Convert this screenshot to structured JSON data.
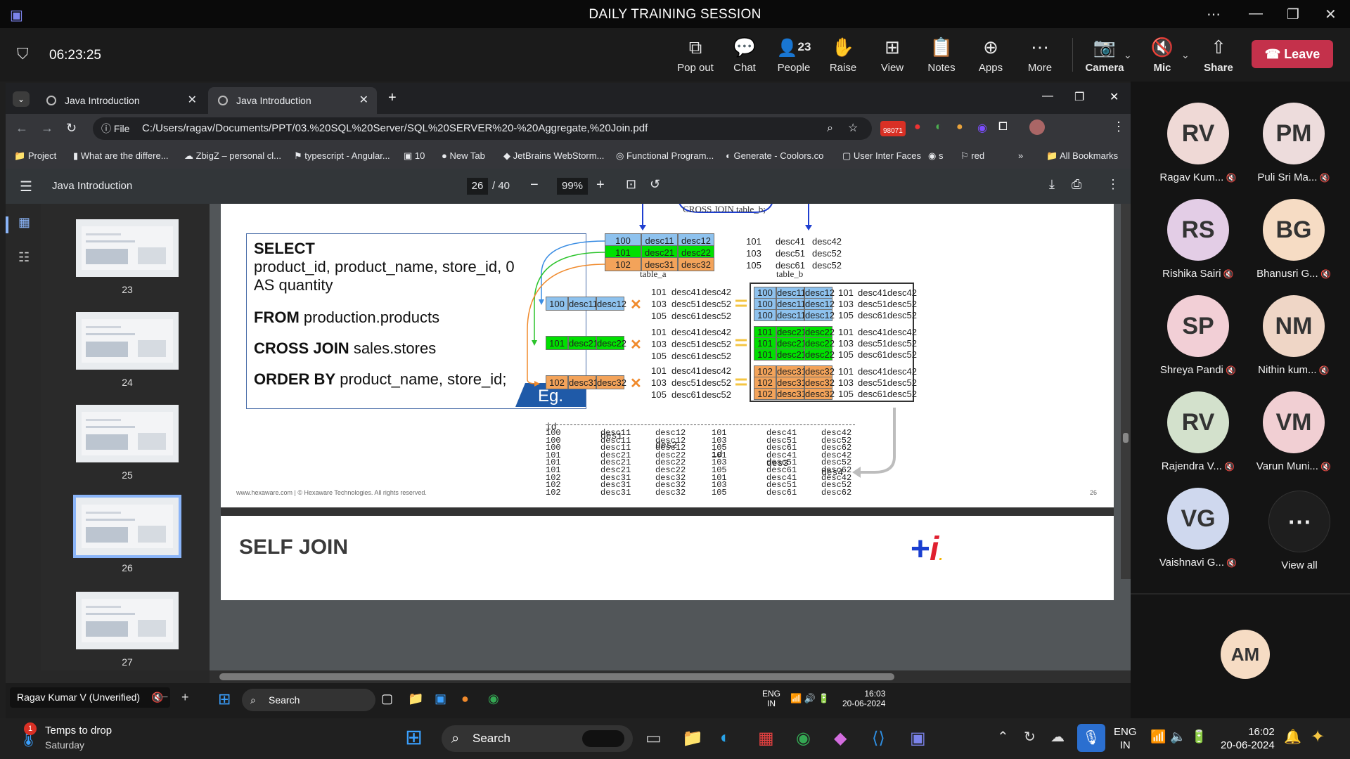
{
  "meeting": {
    "title": "DAILY TRAINING SESSION",
    "timer": "06:23:25",
    "toolbar": {
      "popout": "Pop out",
      "chat": "Chat",
      "people": "People",
      "people_count": "23",
      "raise": "Raise",
      "view": "View",
      "notes": "Notes",
      "apps": "Apps",
      "more": "More",
      "camera": "Camera",
      "mic": "Mic",
      "share": "Share",
      "leave": "Leave"
    }
  },
  "browser": {
    "tabs": [
      {
        "label": "Java Introduction"
      },
      {
        "label": "Java Introduction"
      }
    ],
    "file_label": "File",
    "url": "C:/Users/ragav/Documents/PPT/03.%20SQL%20Server/SQL%20SERVER%20-%20Aggregate,%20Join.pdf",
    "ext_badge": "98071",
    "bookmarks": [
      "Project",
      "What are the differe...",
      "ZbigZ – personal cl...",
      "typescript - Angular...",
      "10",
      "New Tab",
      "JetBrains WebStorm...",
      "Functional Program...",
      "Generate - Coolors.co",
      "User Inter Faces",
      "s",
      "red"
    ],
    "all_bookmarks": "All Bookmarks"
  },
  "pdf": {
    "title": "Java Introduction",
    "page": "26",
    "total": "/ 40",
    "zoom": "99%",
    "thumbs": [
      "23",
      "24",
      "25",
      "26",
      "27"
    ],
    "slide": {
      "select": "SELECT",
      "select_cols": "product_id, product_name, store_id, 0 AS quantity",
      "from_kw": "FROM",
      "from_val": " production.products",
      "cross_kw": "CROSS JOIN",
      "cross_val": " sales.stores",
      "order_kw": "ORDER BY",
      "order_val": " product_name, store_id;",
      "eg": "Eg.",
      "cross_join_label": "CROSS JOIN table_b;",
      "table_a_label": "table_a",
      "table_b_label": "table_b",
      "table_a": [
        [
          "100",
          "desc11",
          "desc12"
        ],
        [
          "101",
          "desc21",
          "desc22"
        ],
        [
          "102",
          "desc31",
          "desc32"
        ]
      ],
      "table_b": [
        [
          "101",
          "desc41",
          "desc42"
        ],
        [
          "103",
          "desc51",
          "desc52"
        ],
        [
          "105",
          "desc61",
          "desc52"
        ]
      ],
      "result_b": [
        [
          "101",
          "desc41",
          "desc42"
        ],
        [
          "103",
          "desc51",
          "desc52"
        ],
        [
          "105",
          "desc61",
          "desc52"
        ]
      ],
      "headers": [
        "id",
        "des1",
        "des2",
        "id",
        "des3",
        "des4"
      ],
      "rows": [
        [
          "100",
          "desc11",
          "desc12",
          "101",
          "desc41",
          "desc42"
        ],
        [
          "100",
          "desc11",
          "desc12",
          "103",
          "desc51",
          "desc52"
        ],
        [
          "100",
          "desc11",
          "desc12",
          "105",
          "desc61",
          "desc62"
        ],
        [
          "101",
          "desc21",
          "desc22",
          "101",
          "desc41",
          "desc42"
        ],
        [
          "101",
          "desc21",
          "desc22",
          "103",
          "desc51",
          "desc52"
        ],
        [
          "101",
          "desc21",
          "desc22",
          "105",
          "desc61",
          "desc62"
        ],
        [
          "102",
          "desc31",
          "desc32",
          "101",
          "desc41",
          "desc42"
        ],
        [
          "102",
          "desc31",
          "desc32",
          "103",
          "desc51",
          "desc52"
        ],
        [
          "102",
          "desc31",
          "desc32",
          "105",
          "desc61",
          "desc62"
        ]
      ],
      "footer": "www.hexaware.com | © Hexaware Technologies. All rights reserved.",
      "page_no": "26"
    },
    "next_slide_title": "SELF JOIN"
  },
  "presenter": "Ragav Kumar V (Unverified)",
  "inner_taskbar": {
    "search": "Search",
    "lang": "ENG",
    "lang2": "IN",
    "time": "16:03",
    "date": "20-06-2024"
  },
  "participants": [
    {
      "initials": "RV",
      "name": "Ragav Kum...",
      "color": "#efd9d6"
    },
    {
      "initials": "PM",
      "name": "Puli Sri Ma...",
      "color": "#eddcdc"
    },
    {
      "initials": "RS",
      "name": "Rishika Sairi",
      "color": "#e3cde6"
    },
    {
      "initials": "BG",
      "name": "Bhanusri G...",
      "color": "#f6dcc4"
    },
    {
      "initials": "SP",
      "name": "Shreya Pandi",
      "color": "#f2cfd6"
    },
    {
      "initials": "NM",
      "name": "Nithin kum...",
      "color": "#efd6c6"
    },
    {
      "initials": "RV",
      "name": "Rajendra V...",
      "color": "#d3e1cc"
    },
    {
      "initials": "VM",
      "name": "Varun Muni...",
      "color": "#f1cfd3"
    },
    {
      "initials": "VG",
      "name": "Vaishnavi G...",
      "color": "#cfd8ee"
    }
  ],
  "view_all": "View all",
  "am_initials": "AM",
  "taskbar": {
    "weather_title": "Temps to drop",
    "weather_sub": "Saturday",
    "search": "Search",
    "lang": "ENG",
    "lang2": "IN",
    "time": "16:02",
    "date": "20-06-2024"
  },
  "colors": {
    "blue": "#8ec2ee",
    "green": "#00e000",
    "orange": "#f3a35a",
    "leave": "#c4314b"
  }
}
